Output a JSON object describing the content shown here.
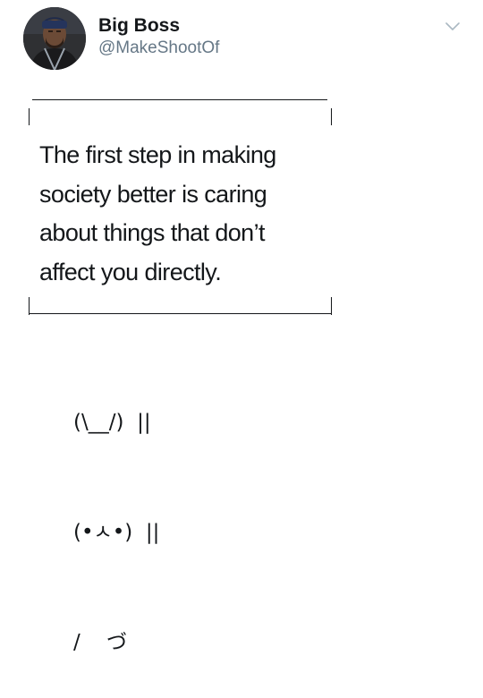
{
  "tweet": {
    "author": {
      "display_name": "Big Boss",
      "handle": "@MakeShootOf",
      "avatar_icon": "avatar-photo"
    },
    "menu_icon": "chevron-down-icon",
    "sign_lines": [
      "The first step in making",
      "society better is caring",
      "about things that don’t",
      "affect you directly."
    ],
    "bunny_lines": [
      "(\\__/)  ||",
      "(•ㅅ•)  ||",
      "/    づ"
    ]
  },
  "colors": {
    "text": "#14171a",
    "secondary_text": "#657786",
    "icon": "#aab8c2",
    "background": "#ffffff"
  }
}
